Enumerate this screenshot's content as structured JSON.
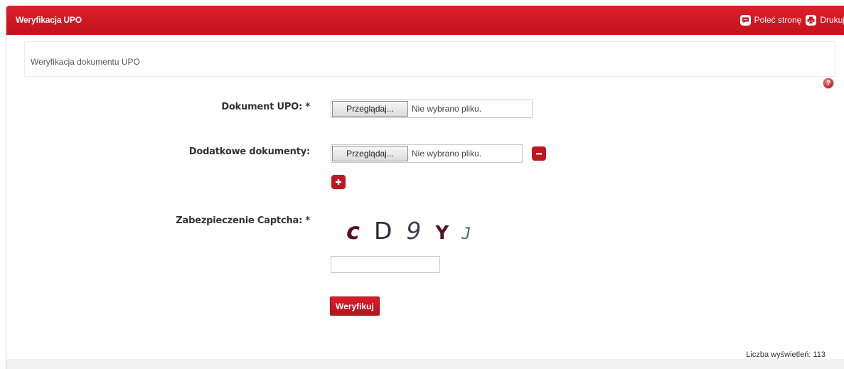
{
  "header": {
    "title": "Weryfikacja UPO",
    "recommend_label": "Poleć stronę",
    "print_label": "Drukuj"
  },
  "breadcrumb": "Weryfikacja dokumentu UPO",
  "form": {
    "upo": {
      "label": "Dokument UPO: *",
      "browse_label": "Przeglądaj...",
      "status": "Nie wybrano pliku."
    },
    "additional": {
      "label": "Dodatkowe dokumenty:",
      "browse_label": "Przeglądaj...",
      "status": "Nie wybrano pliku."
    },
    "captcha": {
      "label": "Zabezpieczenie Captcha: *",
      "chars": [
        "c",
        "D",
        "9",
        "Y",
        "J"
      ],
      "input_value": ""
    },
    "submit_label": "Weryfikuj"
  },
  "footer": {
    "view_count": "Liczba wyświetleń: 113"
  },
  "colors": {
    "accent": "#c8141f",
    "header_gradient_top": "#dd1f2b",
    "footer_strip": "#f2f2f2"
  },
  "icons": {
    "recommend": "chat-bubble-icon",
    "print": "printer-icon",
    "help": "help-icon",
    "remove": "minus-icon",
    "add": "plus-icon"
  }
}
